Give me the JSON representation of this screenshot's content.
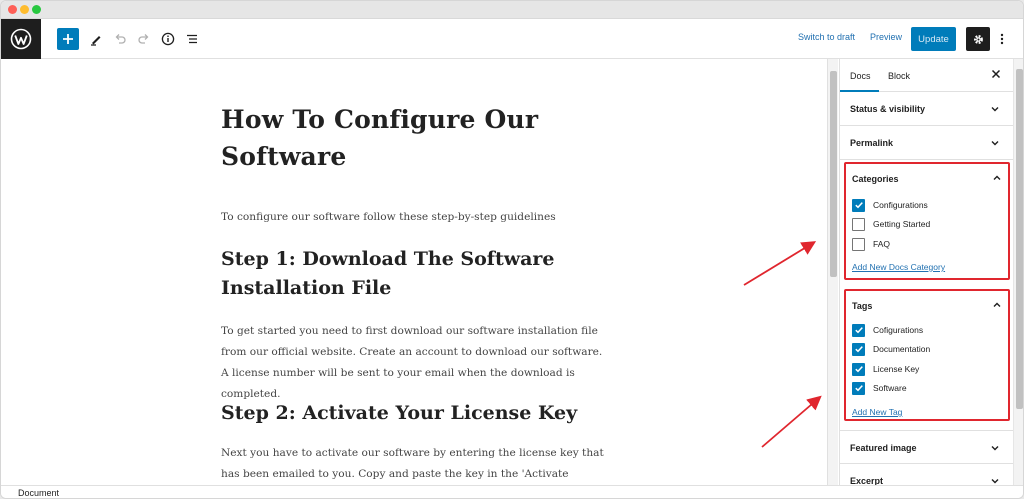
{
  "toolbar": {
    "switch_to_draft": "Switch to draft",
    "preview": "Preview",
    "update": "Update"
  },
  "post": {
    "title": "How To Configure Our Software",
    "intro": "To configure our software follow these step-by-step guidelines",
    "step1_heading": "Step 1: Download The Software Installation File",
    "step1_text": "To get started you need to first download our software installation file from our official website. Create an account to download our software. A license number will be sent to your email when the download is completed.",
    "step2_heading": "Step 2: Activate Your License Key",
    "step2_text": "Next you have to activate our software by entering the license key that has been emailed to you. Copy and paste the key in the 'Activate Software' input"
  },
  "sidebar": {
    "tabs": [
      "Docs",
      "Block"
    ],
    "panels": {
      "status": "Status & visibility",
      "permalink": "Permalink",
      "featured": "Featured image",
      "excerpt": "Excerpt"
    },
    "categories": {
      "title": "Categories",
      "items": [
        {
          "label": "Configurations",
          "checked": true
        },
        {
          "label": "Getting Started",
          "checked": false
        },
        {
          "label": "FAQ",
          "checked": false
        }
      ],
      "add_link": "Add New Docs Category"
    },
    "tags": {
      "title": "Tags",
      "items": [
        {
          "label": "Cofigurations",
          "checked": true
        },
        {
          "label": "Documentation",
          "checked": true
        },
        {
          "label": "License Key",
          "checked": true
        },
        {
          "label": "Software",
          "checked": true
        }
      ],
      "add_link": "Add New Tag"
    }
  },
  "footer": {
    "breadcrumb": "Document"
  },
  "colors": {
    "accent": "#007cba",
    "highlight": "#e0262e"
  }
}
